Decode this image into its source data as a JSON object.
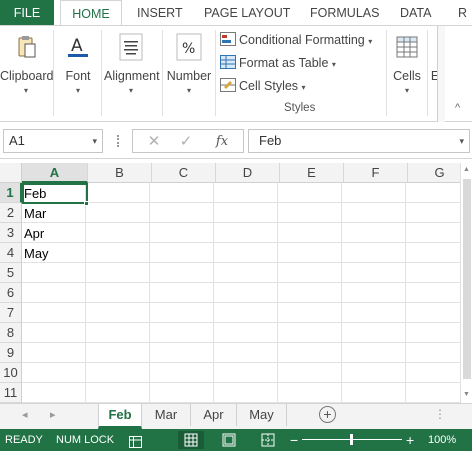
{
  "ribbon_tabs": {
    "file": "FILE",
    "home": "HOME",
    "insert": "INSERT",
    "page_layout": "PAGE LAYOUT",
    "formulas": "FORMULAS",
    "data": "DATA",
    "overflow": "R"
  },
  "ribbon": {
    "clipboard": "Clipboard",
    "font": "Font",
    "alignment": "Alignment",
    "number": "Number",
    "conditional_formatting": "Conditional Formatting",
    "format_as_table": "Format as Table",
    "cell_styles": "Cell Styles",
    "styles_group": "Styles",
    "cells": "Cells",
    "editing": "E",
    "caret": "▾",
    "collapse": "^"
  },
  "formula_bar": {
    "name_box": "A1",
    "fx": "fx",
    "cancel": "✕",
    "enter": "✓",
    "content": "Feb"
  },
  "grid": {
    "columns": [
      "A",
      "B",
      "C",
      "D",
      "E",
      "F",
      "G"
    ],
    "rows": [
      "1",
      "2",
      "3",
      "4",
      "5",
      "6",
      "7",
      "8",
      "9",
      "10",
      "11"
    ],
    "cells": [
      "Feb",
      "Mar",
      "Apr",
      "May"
    ],
    "selected_cell": "A1"
  },
  "sheets": {
    "tabs": [
      "Feb",
      "Mar",
      "Apr",
      "May"
    ],
    "active": "Feb",
    "add": "+",
    "prev": "◂",
    "next": "▸",
    "more": "⋮"
  },
  "status_bar": {
    "ready": "READY",
    "num_lock": "NUM LOCK",
    "zoom_minus": "−",
    "zoom_plus": "+",
    "zoom": "100%",
    "zoom_level": 100
  },
  "colors": {
    "accent": "#217346",
    "grid": "#e2e2e2",
    "header_bg": "#f3f3f3"
  }
}
